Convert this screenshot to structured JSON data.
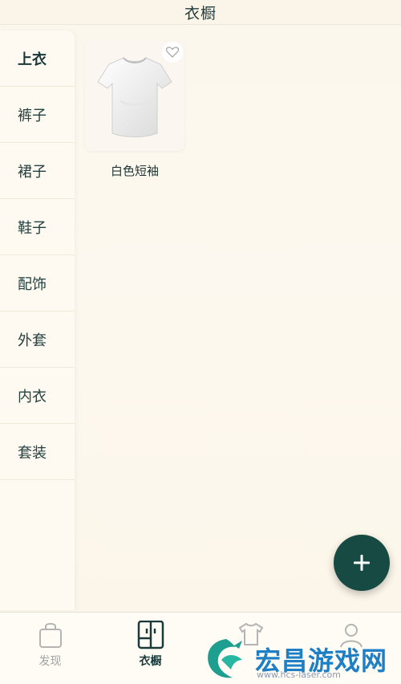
{
  "header": {
    "title": "衣橱"
  },
  "sidebar": {
    "items": [
      {
        "label": "上衣",
        "active": true
      },
      {
        "label": "裤子"
      },
      {
        "label": "裙子"
      },
      {
        "label": "鞋子"
      },
      {
        "label": "配饰"
      },
      {
        "label": "外套"
      },
      {
        "label": "内衣"
      },
      {
        "label": "套装"
      }
    ]
  },
  "items": [
    {
      "name": "白色短袖",
      "icon": "tshirt-image",
      "favorite_icon": "heart-outline-icon"
    }
  ],
  "fab": {
    "icon": "plus-icon",
    "color": "#184a44"
  },
  "tabbar": {
    "tabs": [
      {
        "label": "发现",
        "icon": "shopping-bag-icon"
      },
      {
        "label": "衣橱",
        "icon": "wardrobe-icon",
        "active": true
      },
      {
        "label": "",
        "icon": "shirt-icon"
      },
      {
        "label": "",
        "icon": "profile-icon"
      }
    ]
  },
  "watermark": {
    "text": "宏昌游戏网",
    "url": "www.hcs-laser.com"
  }
}
